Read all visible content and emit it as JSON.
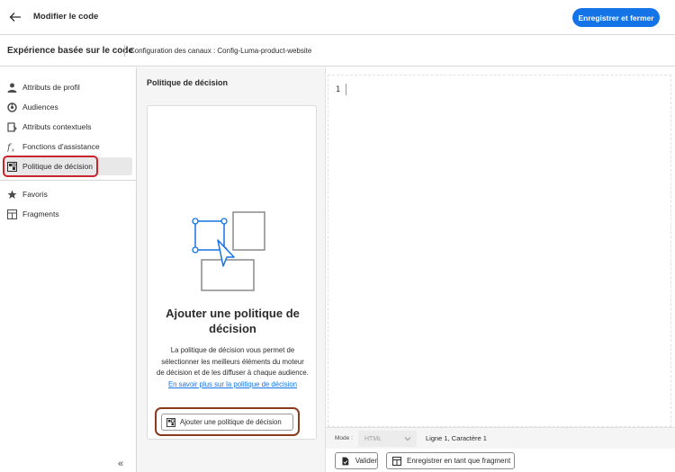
{
  "header": {
    "title": "Modifier le code",
    "primary_button": "Enregistrer et fermer"
  },
  "subheader": {
    "title": "Expérience basée sur le code",
    "channel": "Configuration des canaux : Config-Luma-product-website"
  },
  "sidebar": {
    "items": [
      {
        "label": "Attributs de profil",
        "icon": "person-icon"
      },
      {
        "label": "Audiences",
        "icon": "audience-icon"
      },
      {
        "label": "Attributs contextuels",
        "icon": "context-icon"
      },
      {
        "label": "Fonctions d'assistance",
        "icon": "function-icon"
      },
      {
        "label": "Politique de décision",
        "icon": "decision-icon",
        "active": true
      },
      {
        "label": "Favoris",
        "icon": "star-icon"
      },
      {
        "label": "Fragments",
        "icon": "fragment-icon"
      }
    ],
    "collapse": "«"
  },
  "panel": {
    "title": "Politique de décision",
    "heading": "Ajouter une politique de décision",
    "description": "La politique de décision vous permet de sélectionner les meilleurs éléments du moteur de décision et de les diffuser à chaque audience.",
    "link": "En savoir plus sur la politique de décision",
    "add_button": "Ajouter une politique de décision"
  },
  "editor": {
    "line_number": "1",
    "mode_label": "Mode :",
    "mode_value": "HTML",
    "position": "Ligne 1, Caractère 1",
    "validate_button": "Valider",
    "save_fragment_button": "Enregistrer en tant que fragment"
  },
  "colors": {
    "accent": "#1473e6",
    "highlight": "#c9252d"
  }
}
